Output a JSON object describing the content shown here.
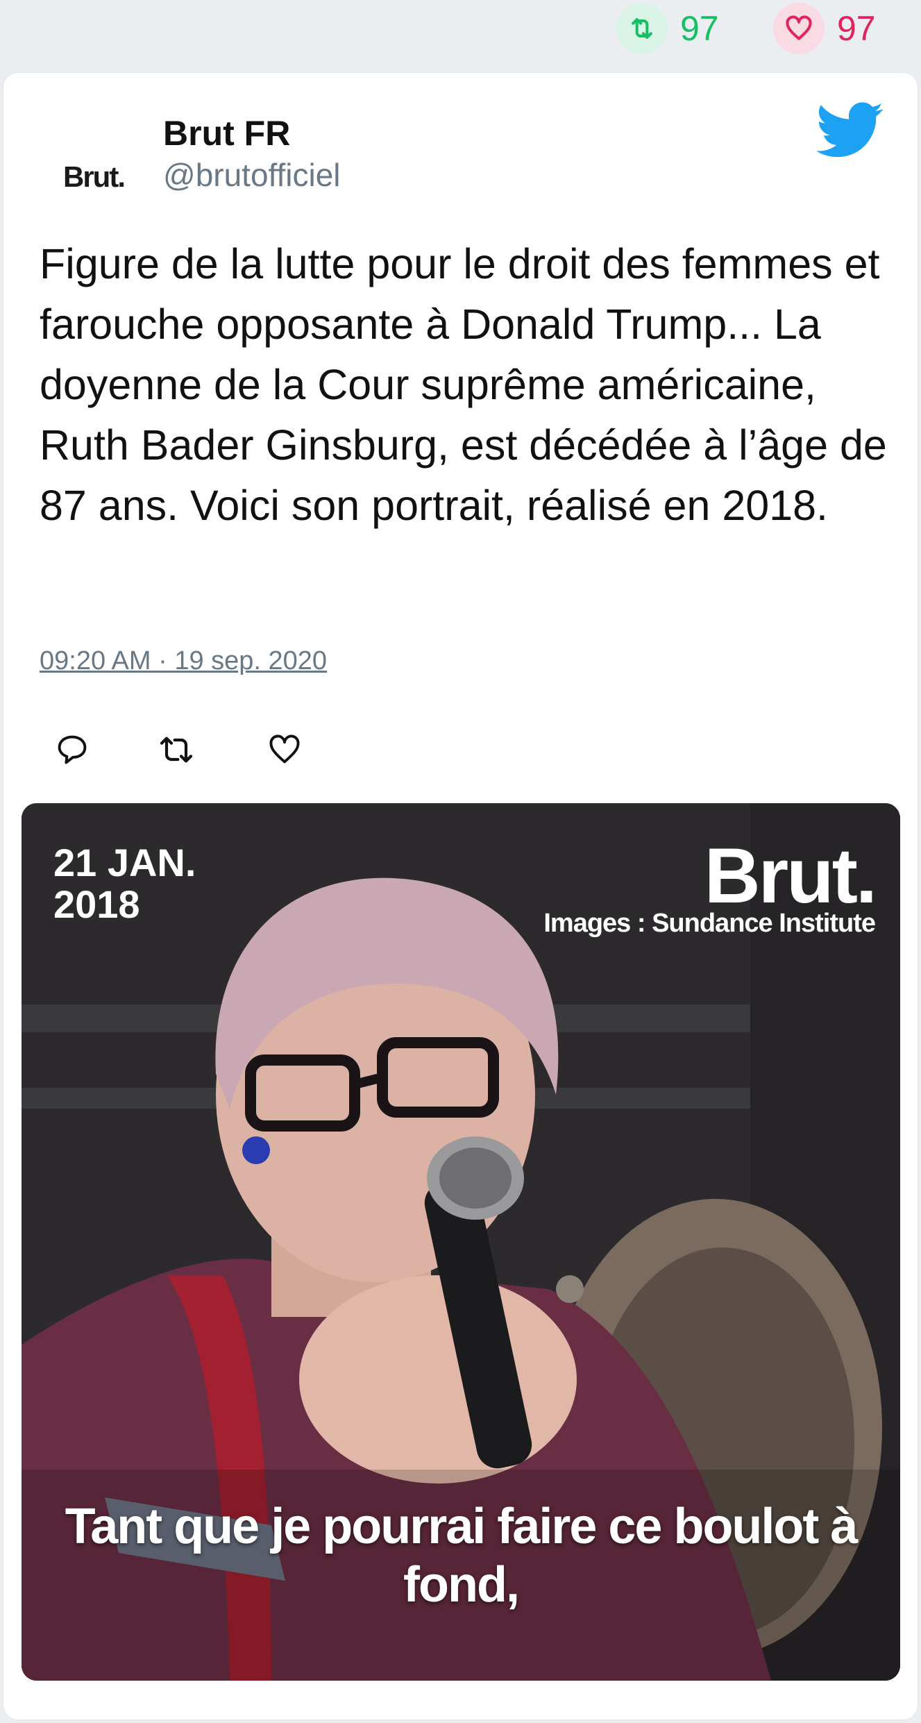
{
  "stats": {
    "retweet_count": "97",
    "like_count": "97",
    "retweet_color": "#17bf63",
    "like_color": "#e0245e"
  },
  "tweet": {
    "avatar_text": "Brut.",
    "author_name": "Brut FR",
    "author_handle": "@brutofficiel",
    "platform_icon": "twitter-bird-icon",
    "text": "Figure de la lutte pour le droit des femmes et farouche opposante à Donald Trump... La doyenne de la Cour suprême américaine, Ruth Bader Ginsburg, est décédée à l’âge de 87 ans. Voici son portrait, réalisé en 2018.",
    "timestamp": "09:20 AM · 19 sep. 2020",
    "actions": [
      "reply-icon",
      "retweet-icon",
      "like-icon"
    ]
  },
  "media": {
    "date_line": "21 JAN. 2018",
    "brand": "Brut.",
    "credit": "Images : Sundance Institute",
    "subtitle": "Tant que je pourrai faire ce boulot à fond,"
  }
}
